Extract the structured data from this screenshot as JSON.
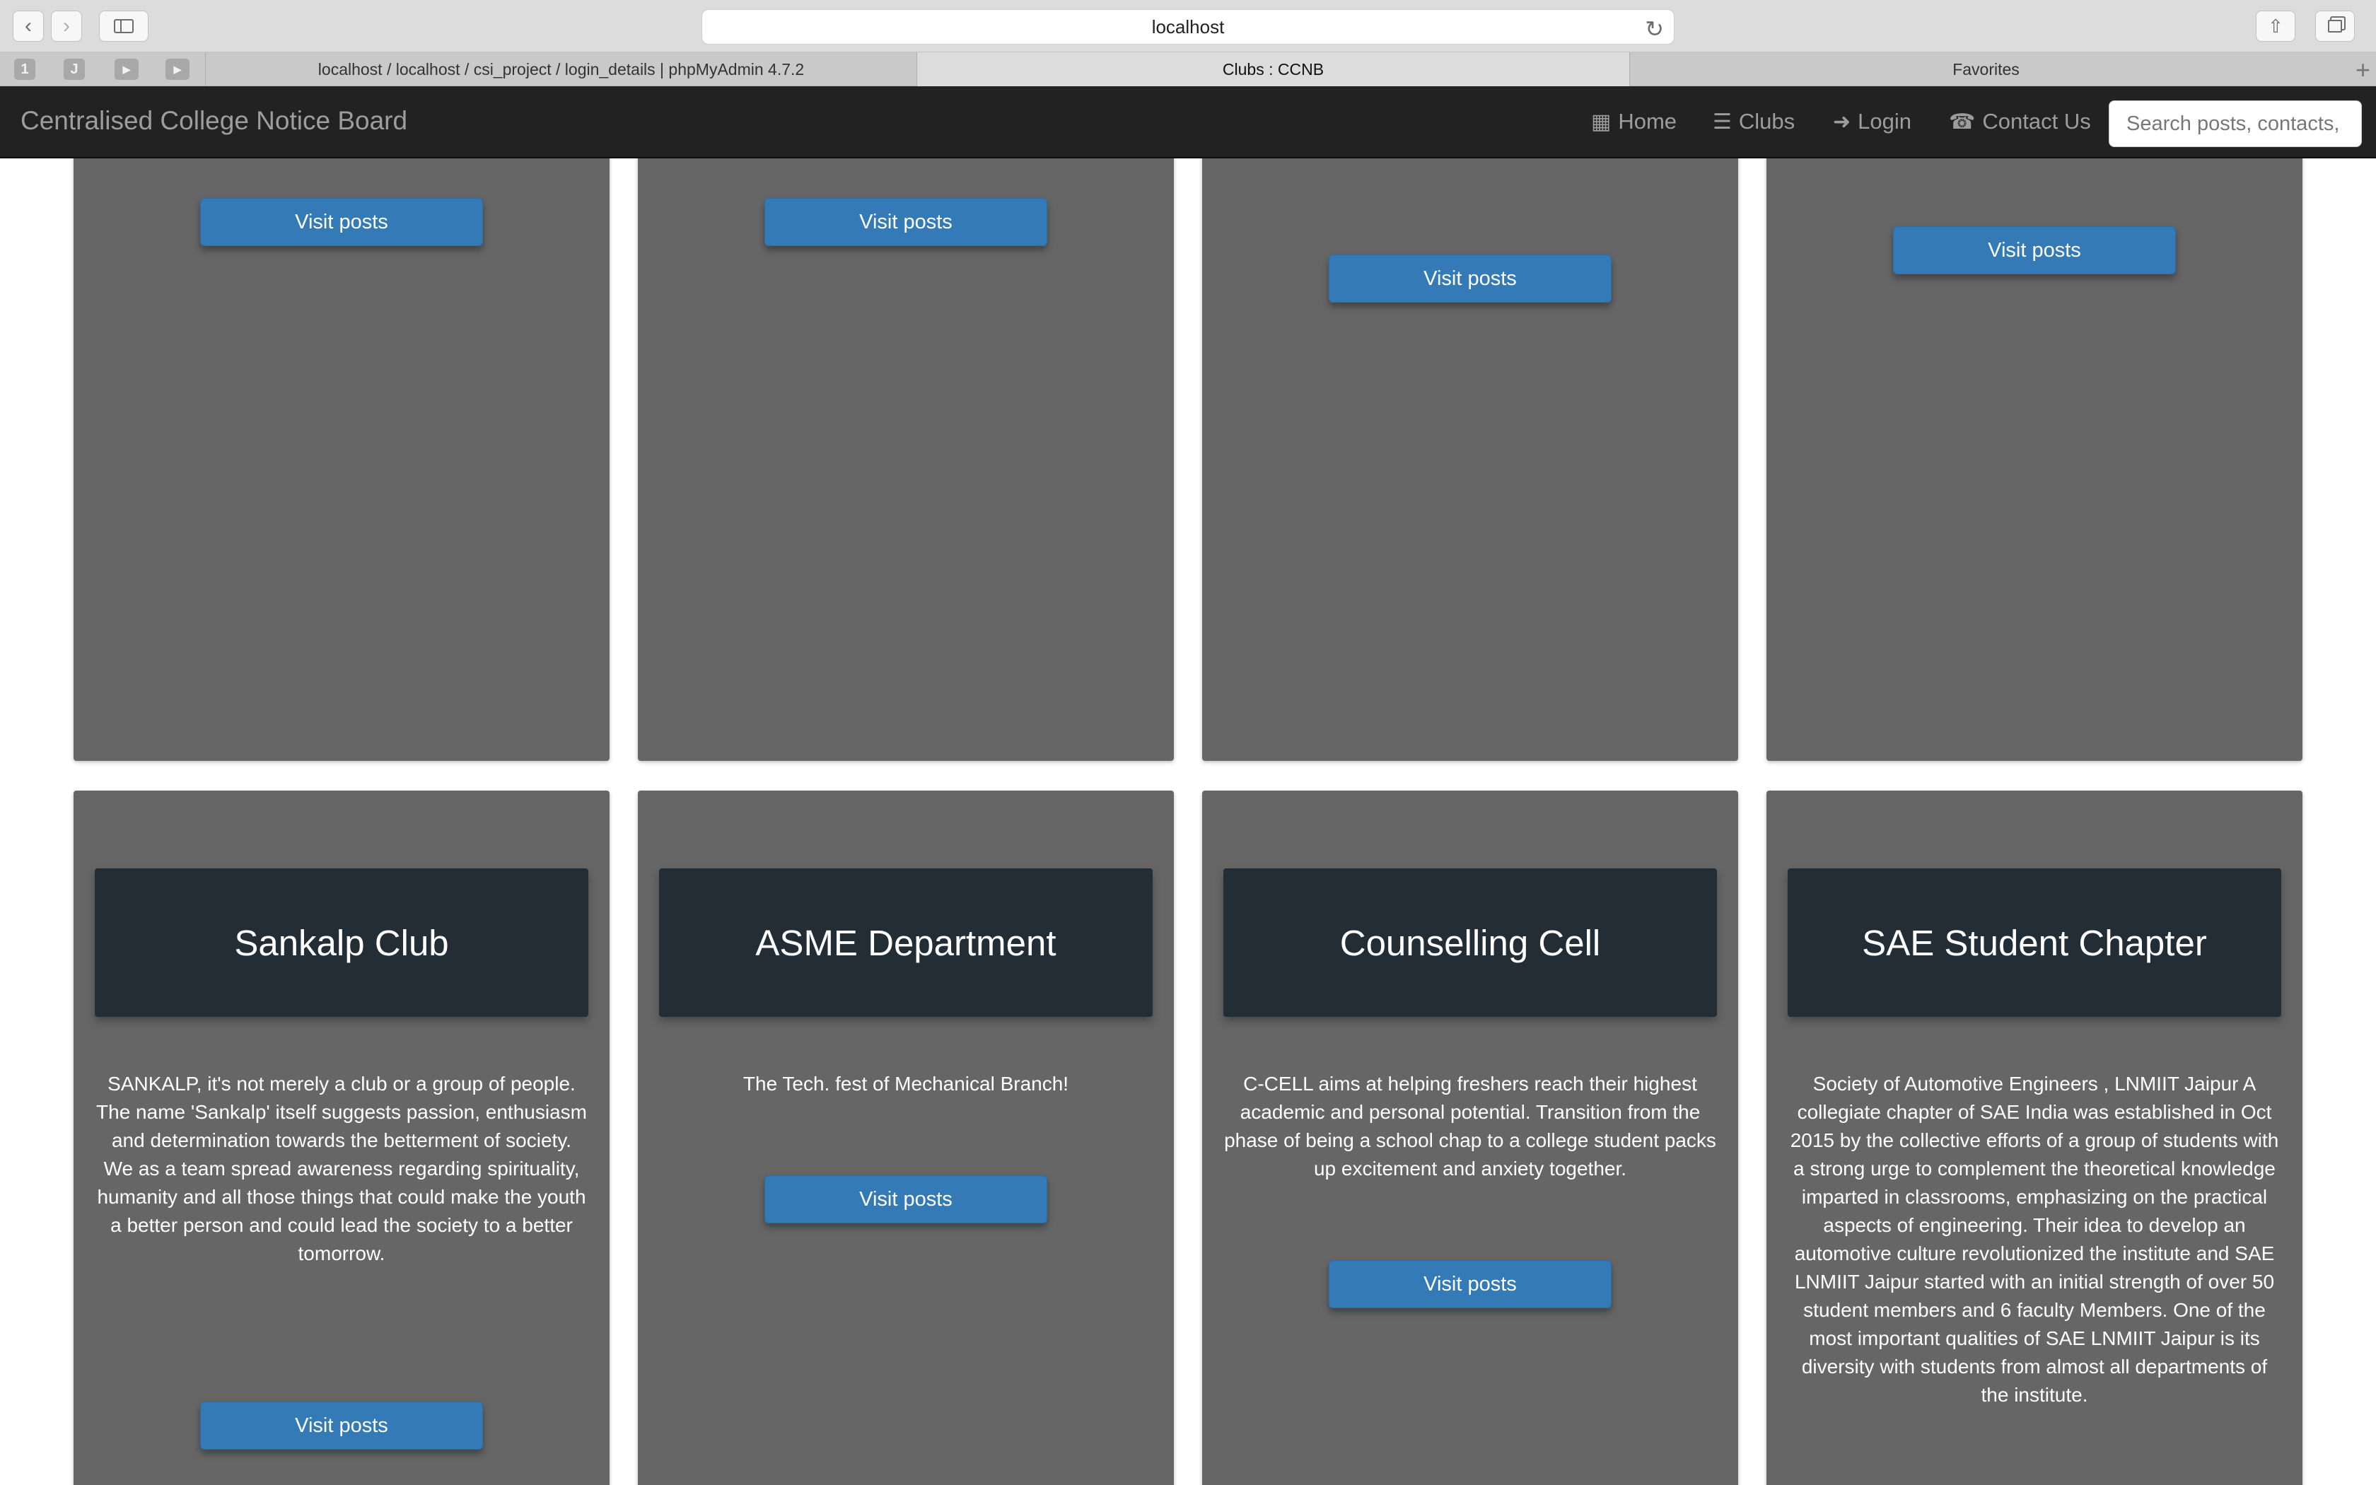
{
  "browser": {
    "url": "localhost",
    "tabs": [
      {
        "title": "localhost / localhost / csi_project / login_details | phpMyAdmin 4.7.2",
        "active": false
      },
      {
        "title": "Clubs : CCNB",
        "active": true
      },
      {
        "title": "Favorites",
        "active": false
      }
    ],
    "pinned": [
      "1",
      "J",
      "",
      ""
    ]
  },
  "navbar": {
    "brand": "Centralised College Notice Board",
    "links": [
      {
        "label": "Home",
        "icon": "grid-icon"
      },
      {
        "label": "Clubs",
        "icon": "list-icon"
      },
      {
        "label": "Login",
        "icon": "login-icon"
      },
      {
        "label": "Contact Us",
        "icon": "phone-icon"
      }
    ],
    "search_placeholder": "Search posts, contacts, clubs"
  },
  "colors": {
    "card_bg": "#666666",
    "card_head_bg": "#232d36",
    "button": "#337ab7",
    "navbar": "#222222"
  },
  "top_cards": [
    {
      "button": "Visit posts"
    },
    {
      "button": "Visit posts"
    },
    {
      "button": "Visit posts"
    },
    {
      "button": "Visit posts"
    }
  ],
  "clubs": [
    {
      "title": "Sankalp Club",
      "description": "SANKALP, it's not merely a club or a group of people. The name 'Sankalp' itself suggests passion, enthusiasm and determination towards the betterment of society. We as a team spread awareness regarding spirituality, humanity and all those things that could make the youth a better person and could lead the society to a better tomorrow.",
      "button": "Visit posts"
    },
    {
      "title": "ASME Department",
      "description": "The Tech. fest of Mechanical Branch!",
      "button": "Visit posts"
    },
    {
      "title": "Counselling Cell",
      "description": "C-CELL aims at helping freshers reach their highest academic and personal potential. Transition from the phase of being a school chap to a college student packs up excitement and anxiety together.",
      "button": "Visit posts"
    },
    {
      "title": "SAE Student Chapter",
      "description": "Society of Automotive Engineers , LNMIIT Jaipur A collegiate chapter of SAE India was established in Oct 2015 by the collective efforts of a group of students with a strong urge to complement the theoretical knowledge imparted in classrooms, emphasizing on the practical aspects of engineering. Their idea to develop an automotive culture revolutionized the institute and SAE LNMIIT Jaipur started with an initial strength of over 50 student members and 6 faculty Members. One of the most important qualities of SAE LNMIIT Jaipur is its diversity with students from almost all departments of the institute.",
      "button": null
    }
  ]
}
